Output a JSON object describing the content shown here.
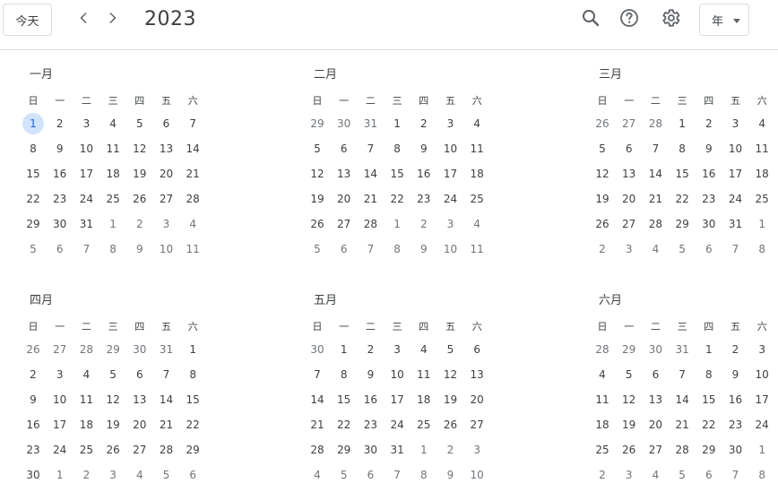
{
  "toolbar": {
    "today_label": "今天",
    "year": "2023",
    "view_label": "年"
  },
  "icons": {
    "prev": "chevron-left-icon",
    "next": "chevron-right-icon",
    "search": "search-icon",
    "help": "help-icon",
    "settings": "gear-icon",
    "dropdown": "caret-down-icon"
  },
  "colors": {
    "today_highlight": "#d2e3fc",
    "today_text": "#1967d2",
    "divider": "#dadce0",
    "text": "#3c4043",
    "muted_text": "#70757a"
  },
  "today": {
    "month_index": 0,
    "day": 1
  },
  "weekdays": [
    "日",
    "一",
    "二",
    "三",
    "四",
    "五",
    "六"
  ],
  "months": [
    {
      "name": "一月",
      "weeks": [
        [
          "1",
          "2",
          "3",
          "4",
          "5",
          "6",
          "7"
        ],
        [
          "8",
          "9",
          "10",
          "11",
          "12",
          "13",
          "14"
        ],
        [
          "15",
          "16",
          "17",
          "18",
          "19",
          "20",
          "21"
        ],
        [
          "22",
          "23",
          "24",
          "25",
          "26",
          "27",
          "28"
        ],
        [
          "29",
          "30",
          "31",
          "1",
          "2",
          "3",
          "4"
        ],
        [
          "5",
          "6",
          "7",
          "8",
          "9",
          "10",
          "11"
        ]
      ],
      "lead_out": 0,
      "trail_out": 11
    },
    {
      "name": "二月",
      "weeks": [
        [
          "29",
          "30",
          "31",
          "1",
          "2",
          "3",
          "4"
        ],
        [
          "5",
          "6",
          "7",
          "8",
          "9",
          "10",
          "11"
        ],
        [
          "12",
          "13",
          "14",
          "15",
          "16",
          "17",
          "18"
        ],
        [
          "19",
          "20",
          "21",
          "22",
          "23",
          "24",
          "25"
        ],
        [
          "26",
          "27",
          "28",
          "1",
          "2",
          "3",
          "4"
        ],
        [
          "5",
          "6",
          "7",
          "8",
          "9",
          "10",
          "11"
        ]
      ],
      "lead_out": 3,
      "trail_out": 11
    },
    {
      "name": "三月",
      "weeks": [
        [
          "26",
          "27",
          "28",
          "1",
          "2",
          "3",
          "4"
        ],
        [
          "5",
          "6",
          "7",
          "8",
          "9",
          "10",
          "11"
        ],
        [
          "12",
          "13",
          "14",
          "15",
          "16",
          "17",
          "18"
        ],
        [
          "19",
          "20",
          "21",
          "22",
          "23",
          "24",
          "25"
        ],
        [
          "26",
          "27",
          "28",
          "29",
          "30",
          "31",
          "1"
        ],
        [
          "2",
          "3",
          "4",
          "5",
          "6",
          "7",
          "8"
        ]
      ],
      "lead_out": 3,
      "trail_out": 8
    },
    {
      "name": "四月",
      "weeks": [
        [
          "26",
          "27",
          "28",
          "29",
          "30",
          "31",
          "1"
        ],
        [
          "2",
          "3",
          "4",
          "5",
          "6",
          "7",
          "8"
        ],
        [
          "9",
          "10",
          "11",
          "12",
          "13",
          "14",
          "15"
        ],
        [
          "16",
          "17",
          "18",
          "19",
          "20",
          "21",
          "22"
        ],
        [
          "23",
          "24",
          "25",
          "26",
          "27",
          "28",
          "29"
        ],
        [
          "30",
          "1",
          "2",
          "3",
          "4",
          "5",
          "6"
        ]
      ],
      "lead_out": 6,
      "trail_out": 6
    },
    {
      "name": "五月",
      "weeks": [
        [
          "30",
          "1",
          "2",
          "3",
          "4",
          "5",
          "6"
        ],
        [
          "7",
          "8",
          "9",
          "10",
          "11",
          "12",
          "13"
        ],
        [
          "14",
          "15",
          "16",
          "17",
          "18",
          "19",
          "20"
        ],
        [
          "21",
          "22",
          "23",
          "24",
          "25",
          "26",
          "27"
        ],
        [
          "28",
          "29",
          "30",
          "31",
          "1",
          "2",
          "3"
        ],
        [
          "4",
          "5",
          "6",
          "7",
          "8",
          "9",
          "10"
        ]
      ],
      "lead_out": 1,
      "trail_out": 10
    },
    {
      "name": "六月",
      "weeks": [
        [
          "28",
          "29",
          "30",
          "31",
          "1",
          "2",
          "3"
        ],
        [
          "4",
          "5",
          "6",
          "7",
          "8",
          "9",
          "10"
        ],
        [
          "11",
          "12",
          "13",
          "14",
          "15",
          "16",
          "17"
        ],
        [
          "18",
          "19",
          "20",
          "21",
          "22",
          "23",
          "24"
        ],
        [
          "25",
          "26",
          "27",
          "28",
          "29",
          "30",
          "1"
        ],
        [
          "2",
          "3",
          "4",
          "5",
          "6",
          "7",
          "8"
        ]
      ],
      "lead_out": 4,
      "trail_out": 8
    }
  ]
}
